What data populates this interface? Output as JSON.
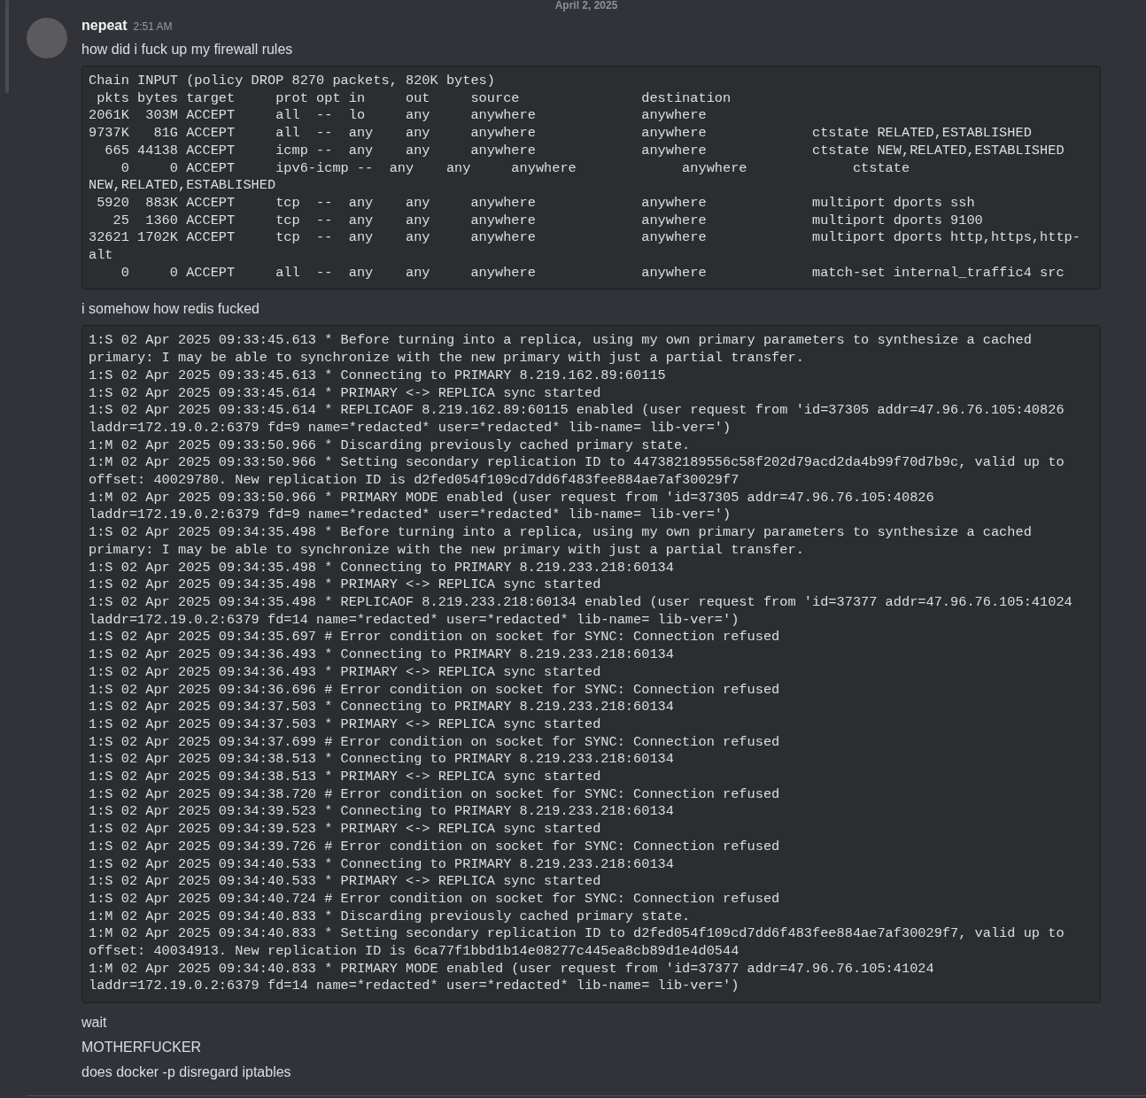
{
  "date_divider": "April 2, 2025",
  "message": {
    "author": "nepeat",
    "time": "2:51 AM",
    "blocks": [
      {
        "kind": "text",
        "text": "how did i fuck up my firewall rules"
      },
      {
        "kind": "code",
        "lines": [
          "Chain INPUT (policy DROP 8270 packets, 820K bytes)",
          " pkts bytes target     prot opt in     out     source               destination",
          "2061K  303M ACCEPT     all  --  lo     any     anywhere             anywhere",
          "9737K   81G ACCEPT     all  --  any    any     anywhere             anywhere             ctstate RELATED,ESTABLISHED",
          "  665 44138 ACCEPT     icmp --  any    any     anywhere             anywhere             ctstate NEW,RELATED,ESTABLISHED",
          "    0     0 ACCEPT     ipv6-icmp --  any    any     anywhere             anywhere             ctstate",
          "NEW,RELATED,ESTABLISHED",
          " 5920  883K ACCEPT     tcp  --  any    any     anywhere             anywhere             multiport dports ssh",
          "   25  1360 ACCEPT     tcp  --  any    any     anywhere             anywhere             multiport dports 9100",
          "32621 1702K ACCEPT     tcp  --  any    any     anywhere             anywhere             multiport dports http,https,http-",
          "alt",
          "    0     0 ACCEPT     all  --  any    any     anywhere             anywhere             match-set internal_traffic4 src"
        ]
      },
      {
        "kind": "text",
        "text": "i somehow how redis fucked"
      },
      {
        "kind": "code",
        "lines": [
          "1:S 02 Apr 2025 09:33:45.613 * Before turning into a replica, using my own primary parameters to synthesize a cached",
          "primary: I may be able to synchronize with the new primary with just a partial transfer.",
          "1:S 02 Apr 2025 09:33:45.613 * Connecting to PRIMARY 8.219.162.89:60115",
          "1:S 02 Apr 2025 09:33:45.614 * PRIMARY <-> REPLICA sync started",
          "1:S 02 Apr 2025 09:33:45.614 * REPLICAOF 8.219.162.89:60115 enabled (user request from 'id=37305 addr=47.96.76.105:40826",
          "laddr=172.19.0.2:6379 fd=9 name=*redacted* user=*redacted* lib-name= lib-ver=')",
          "1:M 02 Apr 2025 09:33:50.966 * Discarding previously cached primary state.",
          "1:M 02 Apr 2025 09:33:50.966 * Setting secondary replication ID to 447382189556c58f202d79acd2da4b99f70d7b9c, valid up to",
          "offset: 40029780. New replication ID is d2fed054f109cd7dd6f483fee884ae7af30029f7",
          "1:M 02 Apr 2025 09:33:50.966 * PRIMARY MODE enabled (user request from 'id=37305 addr=47.96.76.105:40826",
          "laddr=172.19.0.2:6379 fd=9 name=*redacted* user=*redacted* lib-name= lib-ver=')",
          "1:S 02 Apr 2025 09:34:35.498 * Before turning into a replica, using my own primary parameters to synthesize a cached",
          "primary: I may be able to synchronize with the new primary with just a partial transfer.",
          "1:S 02 Apr 2025 09:34:35.498 * Connecting to PRIMARY 8.219.233.218:60134",
          "1:S 02 Apr 2025 09:34:35.498 * PRIMARY <-> REPLICA sync started",
          "1:S 02 Apr 2025 09:34:35.498 * REPLICAOF 8.219.233.218:60134 enabled (user request from 'id=37377 addr=47.96.76.105:41024",
          "laddr=172.19.0.2:6379 fd=14 name=*redacted* user=*redacted* lib-name= lib-ver=')",
          "1:S 02 Apr 2025 09:34:35.697 # Error condition on socket for SYNC: Connection refused",
          "1:S 02 Apr 2025 09:34:36.493 * Connecting to PRIMARY 8.219.233.218:60134",
          "1:S 02 Apr 2025 09:34:36.493 * PRIMARY <-> REPLICA sync started",
          "1:S 02 Apr 2025 09:34:36.696 # Error condition on socket for SYNC: Connection refused",
          "1:S 02 Apr 2025 09:34:37.503 * Connecting to PRIMARY 8.219.233.218:60134",
          "1:S 02 Apr 2025 09:34:37.503 * PRIMARY <-> REPLICA sync started",
          "1:S 02 Apr 2025 09:34:37.699 # Error condition on socket for SYNC: Connection refused",
          "1:S 02 Apr 2025 09:34:38.513 * Connecting to PRIMARY 8.219.233.218:60134",
          "1:S 02 Apr 2025 09:34:38.513 * PRIMARY <-> REPLICA sync started",
          "1:S 02 Apr 2025 09:34:38.720 # Error condition on socket for SYNC: Connection refused",
          "1:S 02 Apr 2025 09:34:39.523 * Connecting to PRIMARY 8.219.233.218:60134",
          "1:S 02 Apr 2025 09:34:39.523 * PRIMARY <-> REPLICA sync started",
          "1:S 02 Apr 2025 09:34:39.726 # Error condition on socket for SYNC: Connection refused",
          "1:S 02 Apr 2025 09:34:40.533 * Connecting to PRIMARY 8.219.233.218:60134",
          "1:S 02 Apr 2025 09:34:40.533 * PRIMARY <-> REPLICA sync started",
          "1:S 02 Apr 2025 09:34:40.724 # Error condition on socket for SYNC: Connection refused",
          "1:M 02 Apr 2025 09:34:40.833 * Discarding previously cached primary state.",
          "1:M 02 Apr 2025 09:34:40.833 * Setting secondary replication ID to d2fed054f109cd7dd6f483fee884ae7af30029f7, valid up to",
          "offset: 40034913. New replication ID is 6ca77f1bbd1b14e08277c445ea8cb89d1e4d0544",
          "1:M 02 Apr 2025 09:34:40.833 * PRIMARY MODE enabled (user request from 'id=37377 addr=47.96.76.105:41024",
          "laddr=172.19.0.2:6379 fd=14 name=*redacted* user=*redacted* lib-name= lib-ver=')"
        ]
      },
      {
        "kind": "text",
        "text": "wait"
      },
      {
        "kind": "text",
        "text": "MOTHERFUCKER"
      },
      {
        "kind": "text",
        "text": "does docker -p disregard iptables"
      }
    ]
  }
}
